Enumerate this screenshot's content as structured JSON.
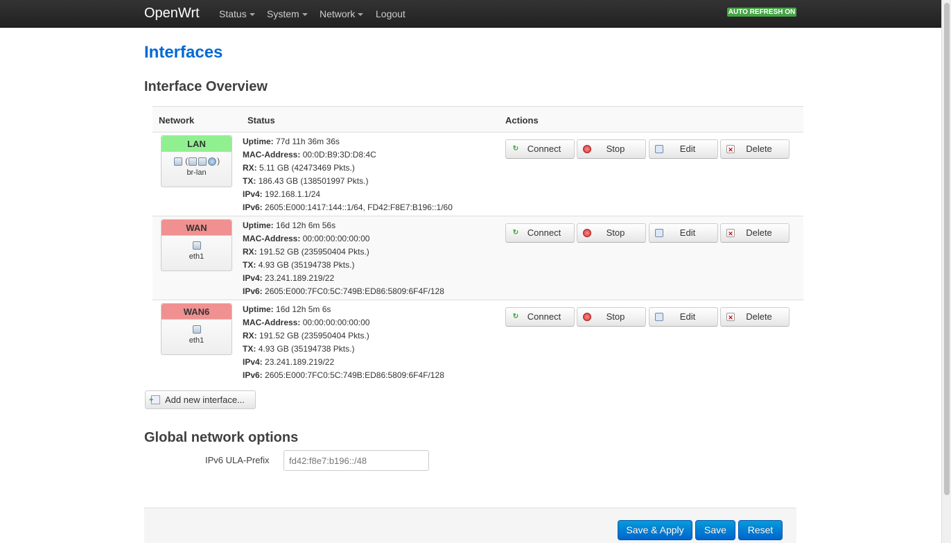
{
  "nav": {
    "brand": "OpenWrt",
    "menus": [
      "Status",
      "System",
      "Network",
      "Logout"
    ],
    "auto_refresh": "AUTO REFRESH ON"
  },
  "page": {
    "title": "Interfaces",
    "overview_title": "Interface Overview",
    "global_title": "Global network options"
  },
  "table": {
    "headers": [
      "Network",
      "Status",
      "Actions"
    ],
    "status_labels": {
      "uptime": "Uptime:",
      "mac": "MAC-Address:",
      "rx": "RX:",
      "tx": "TX:",
      "ipv4": "IPv4:",
      "ipv6": "IPv6:"
    },
    "actions": [
      "Connect",
      "Stop",
      "Edit",
      "Delete"
    ],
    "rows": [
      {
        "name": "LAN",
        "color": "#90f090",
        "device": "br-lan",
        "uptime": "77d 11h 36m 36s",
        "mac": "00:0D:B9:3D:D8:4C",
        "rx": "5.11 GB (42473469 Pkts.)",
        "tx": "186.43 GB (138501997 Pkts.)",
        "ipv4": "192.168.1.1/24",
        "ipv6": "2605:E000:1417:144::1/64, FD42:F8E7:B196::1/60"
      },
      {
        "name": "WAN",
        "color": "#f09090",
        "device": "eth1",
        "uptime": "16d 12h 6m 56s",
        "mac": "00:00:00:00:00:00",
        "rx": "191.52 GB (235950404 Pkts.)",
        "tx": "4.93 GB (35194738 Pkts.)",
        "ipv4": "23.241.189.219/22",
        "ipv6": "2605:E000:7FC0:5C:749B:ED86:5809:6F4F/128"
      },
      {
        "name": "WAN6",
        "color": "#f09090",
        "device": "eth1",
        "uptime": "16d 12h 5m 6s",
        "mac": "00:00:00:00:00:00",
        "rx": "191.52 GB (235950404 Pkts.)",
        "tx": "4.93 GB (35194738 Pkts.)",
        "ipv4": "23.241.189.219/22",
        "ipv6": "2605:E000:7FC0:5C:749B:ED86:5809:6F4F/128"
      }
    ]
  },
  "add_interface": "Add new interface...",
  "global": {
    "ula_label": "IPv6 ULA-Prefix",
    "ula_value": "fd42:f8e7:b196::/48"
  },
  "footer": {
    "save_apply": "Save & Apply",
    "save": "Save",
    "reset": "Reset"
  }
}
